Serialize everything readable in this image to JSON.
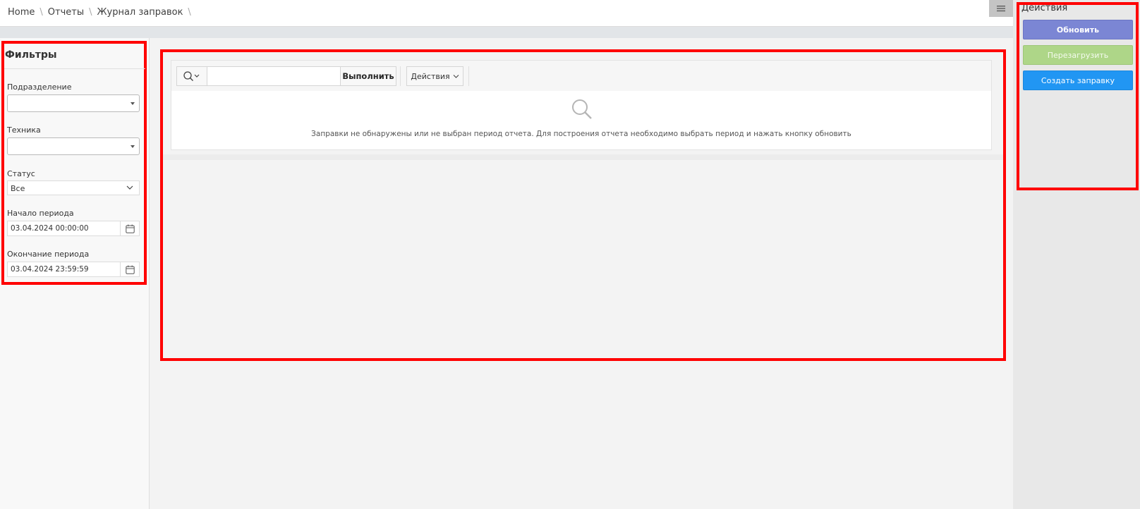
{
  "breadcrumb": {
    "items": [
      "Home",
      "Отчеты",
      "Журнал заправок"
    ],
    "separator": "\\"
  },
  "filters": {
    "title": "Фильтры",
    "division": {
      "label": "Подразделение",
      "value": ""
    },
    "equipment": {
      "label": "Техника",
      "value": ""
    },
    "status": {
      "label": "Статус",
      "value": "Все"
    },
    "period_start": {
      "label": "Начало периода",
      "value": "03.04.2024 00:00:00"
    },
    "period_end": {
      "label": "Окончание периода",
      "value": "03.04.2024 23:59:59"
    }
  },
  "report": {
    "search": {
      "placeholder": "",
      "value": ""
    },
    "run_label": "Выполнить",
    "actions_label": "Действия",
    "empty_message": "Заправки не обнаружены или не выбран период отчета. Для построения отчета необходимо выбрать период и нажать кнопку обновить"
  },
  "actions_panel": {
    "title": "Действия",
    "refresh_label": "Обновить",
    "reload_label": "Перезагрузить",
    "create_label": "Создать заправку"
  },
  "colors": {
    "highlight": "#ff0000",
    "refresh": "#7b86d4",
    "reload": "#aed688",
    "create": "#2196f3"
  }
}
